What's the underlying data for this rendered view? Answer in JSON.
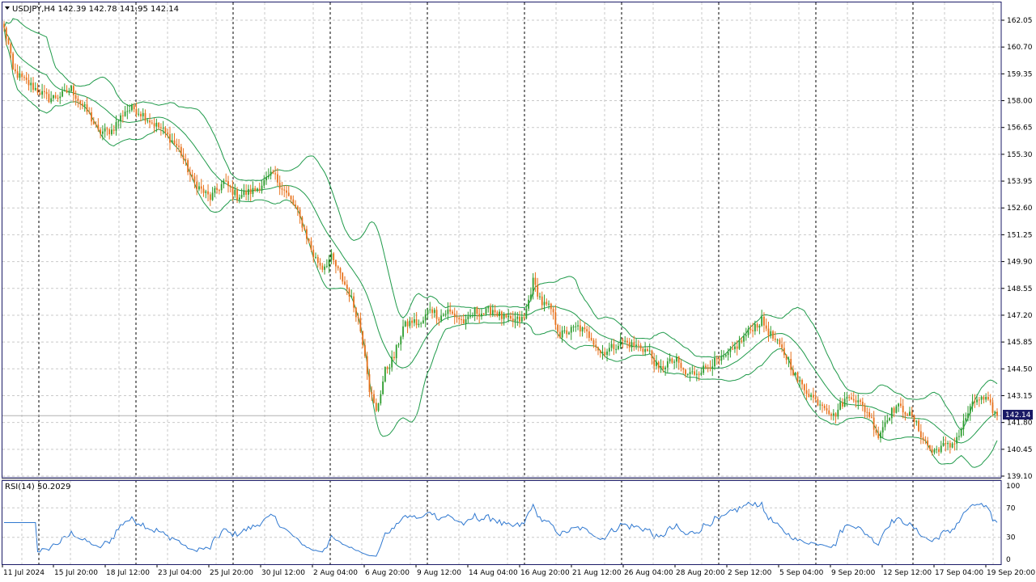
{
  "main_header": {
    "text": "USDJPY,H4  142.39 142.78 141.95 142.14"
  },
  "rsi_header": {
    "text": "RSI(14) 50.2029"
  },
  "current_price_label": "142.14",
  "colors": {
    "bull": "#2e9d2e",
    "bear": "#e8721c",
    "band": "#1f9a4a",
    "rsi": "#2f78d0",
    "grid": "#c9c9c9",
    "frame": "#1a1a66",
    "price_tag": "#1a1a66"
  },
  "price_axis": {
    "labels": [
      "162.05",
      "160.70",
      "159.35",
      "158.00",
      "156.65",
      "155.30",
      "153.95",
      "152.60",
      "151.25",
      "149.90",
      "148.55",
      "147.20",
      "145.85",
      "144.50",
      "143.15",
      "141.80",
      "140.45",
      "139.10"
    ]
  },
  "rsi_axis": {
    "labels": [
      "100",
      "70",
      "30",
      "0"
    ]
  },
  "time_axis": {
    "labels": [
      "11 Jul 2024",
      "15 Jul 20:00",
      "18 Jul 12:00",
      "23 Jul 04:00",
      "25 Jul 20:00",
      "30 Jul 12:00",
      "2 Aug 04:00",
      "6 Aug 20:00",
      "9 Aug 12:00",
      "14 Aug 04:00",
      "16 Aug 20:00",
      "21 Aug 12:00",
      "26 Aug 04:00",
      "28 Aug 20:00",
      "2 Sep 12:00",
      "5 Sep 04:00",
      "9 Sep 20:00",
      "12 Sep 12:00",
      "17 Sep 04:00",
      "19 Sep 20:00"
    ]
  },
  "chart_data": {
    "type": "candlestick",
    "symbol": "USDJPY",
    "timeframe": "H4",
    "ylim": [
      139.1,
      162.05
    ],
    "anchors_close": [
      [
        0,
        161.6
      ],
      [
        2,
        160.8
      ],
      [
        4,
        159.5
      ],
      [
        8,
        159.1
      ],
      [
        14,
        158.6
      ],
      [
        20,
        158.1
      ],
      [
        26,
        158.3
      ],
      [
        30,
        158.6
      ],
      [
        34,
        157.9
      ],
      [
        38,
        157.3
      ],
      [
        42,
        156.4
      ],
      [
        48,
        156.5
      ],
      [
        54,
        157.5
      ],
      [
        58,
        157.6
      ],
      [
        62,
        157.3
      ],
      [
        66,
        156.9
      ],
      [
        70,
        156.6
      ],
      [
        74,
        156.1
      ],
      [
        78,
        155.6
      ],
      [
        84,
        154.0
      ],
      [
        88,
        153.5
      ],
      [
        92,
        153.1
      ],
      [
        98,
        153.9
      ],
      [
        104,
        153.2
      ],
      [
        112,
        153.5
      ],
      [
        120,
        154.3
      ],
      [
        126,
        153.3
      ],
      [
        130,
        152.6
      ],
      [
        134,
        151.5
      ],
      [
        138,
        150.2
      ],
      [
        142,
        149.6
      ],
      [
        146,
        150.1
      ],
      [
        150,
        149.2
      ],
      [
        154,
        148.3
      ],
      [
        158,
        147.0
      ],
      [
        161,
        145.3
      ],
      [
        163,
        143.5
      ],
      [
        166,
        142.3
      ],
      [
        170,
        144.4
      ],
      [
        174,
        145.1
      ],
      [
        178,
        146.6
      ],
      [
        182,
        146.9
      ],
      [
        186,
        146.7
      ],
      [
        190,
        147.6
      ],
      [
        194,
        147.1
      ],
      [
        198,
        147.4
      ],
      [
        202,
        147.1
      ],
      [
        206,
        146.8
      ],
      [
        210,
        147.4
      ],
      [
        214,
        147.3
      ],
      [
        218,
        147.5
      ],
      [
        222,
        147.1
      ],
      [
        226,
        146.9
      ],
      [
        232,
        147.0
      ],
      [
        236,
        148.9
      ],
      [
        240,
        147.8
      ],
      [
        244,
        147.5
      ],
      [
        248,
        146.2
      ],
      [
        252,
        146.4
      ],
      [
        256,
        146.6
      ],
      [
        262,
        146.1
      ],
      [
        266,
        145.3
      ],
      [
        270,
        145.5
      ],
      [
        276,
        145.9
      ],
      [
        280,
        145.7
      ],
      [
        284,
        145.6
      ],
      [
        288,
        145.3
      ],
      [
        292,
        144.4
      ],
      [
        296,
        144.8
      ],
      [
        300,
        144.9
      ],
      [
        304,
        144.2
      ],
      [
        308,
        144.3
      ],
      [
        312,
        144.5
      ],
      [
        316,
        144.8
      ],
      [
        320,
        144.9
      ],
      [
        324,
        145.3
      ],
      [
        328,
        145.8
      ],
      [
        334,
        146.6
      ],
      [
        338,
        146.9
      ],
      [
        342,
        146.2
      ],
      [
        346,
        145.6
      ],
      [
        350,
        144.9
      ],
      [
        354,
        143.9
      ],
      [
        358,
        143.4
      ],
      [
        362,
        142.9
      ],
      [
        366,
        142.7
      ],
      [
        370,
        142.1
      ],
      [
        374,
        142.8
      ],
      [
        378,
        143.2
      ],
      [
        382,
        142.7
      ],
      [
        386,
        142.2
      ],
      [
        390,
        141.1
      ],
      [
        394,
        142.1
      ],
      [
        398,
        142.6
      ],
      [
        402,
        142.4
      ],
      [
        406,
        141.9
      ],
      [
        410,
        141.0
      ],
      [
        414,
        140.3
      ],
      [
        418,
        140.6
      ],
      [
        422,
        140.6
      ],
      [
        426,
        141.2
      ],
      [
        430,
        142.3
      ],
      [
        434,
        143.0
      ],
      [
        438,
        142.9
      ],
      [
        442,
        142.3
      ],
      [
        443,
        142.14
      ]
    ],
    "candles_count": 444,
    "indicators": {
      "bollinger_bands": {
        "color": "#1f9a4a"
      },
      "rsi": {
        "period": 14,
        "last": 50.2029,
        "levels": [
          70,
          30
        ]
      }
    }
  }
}
